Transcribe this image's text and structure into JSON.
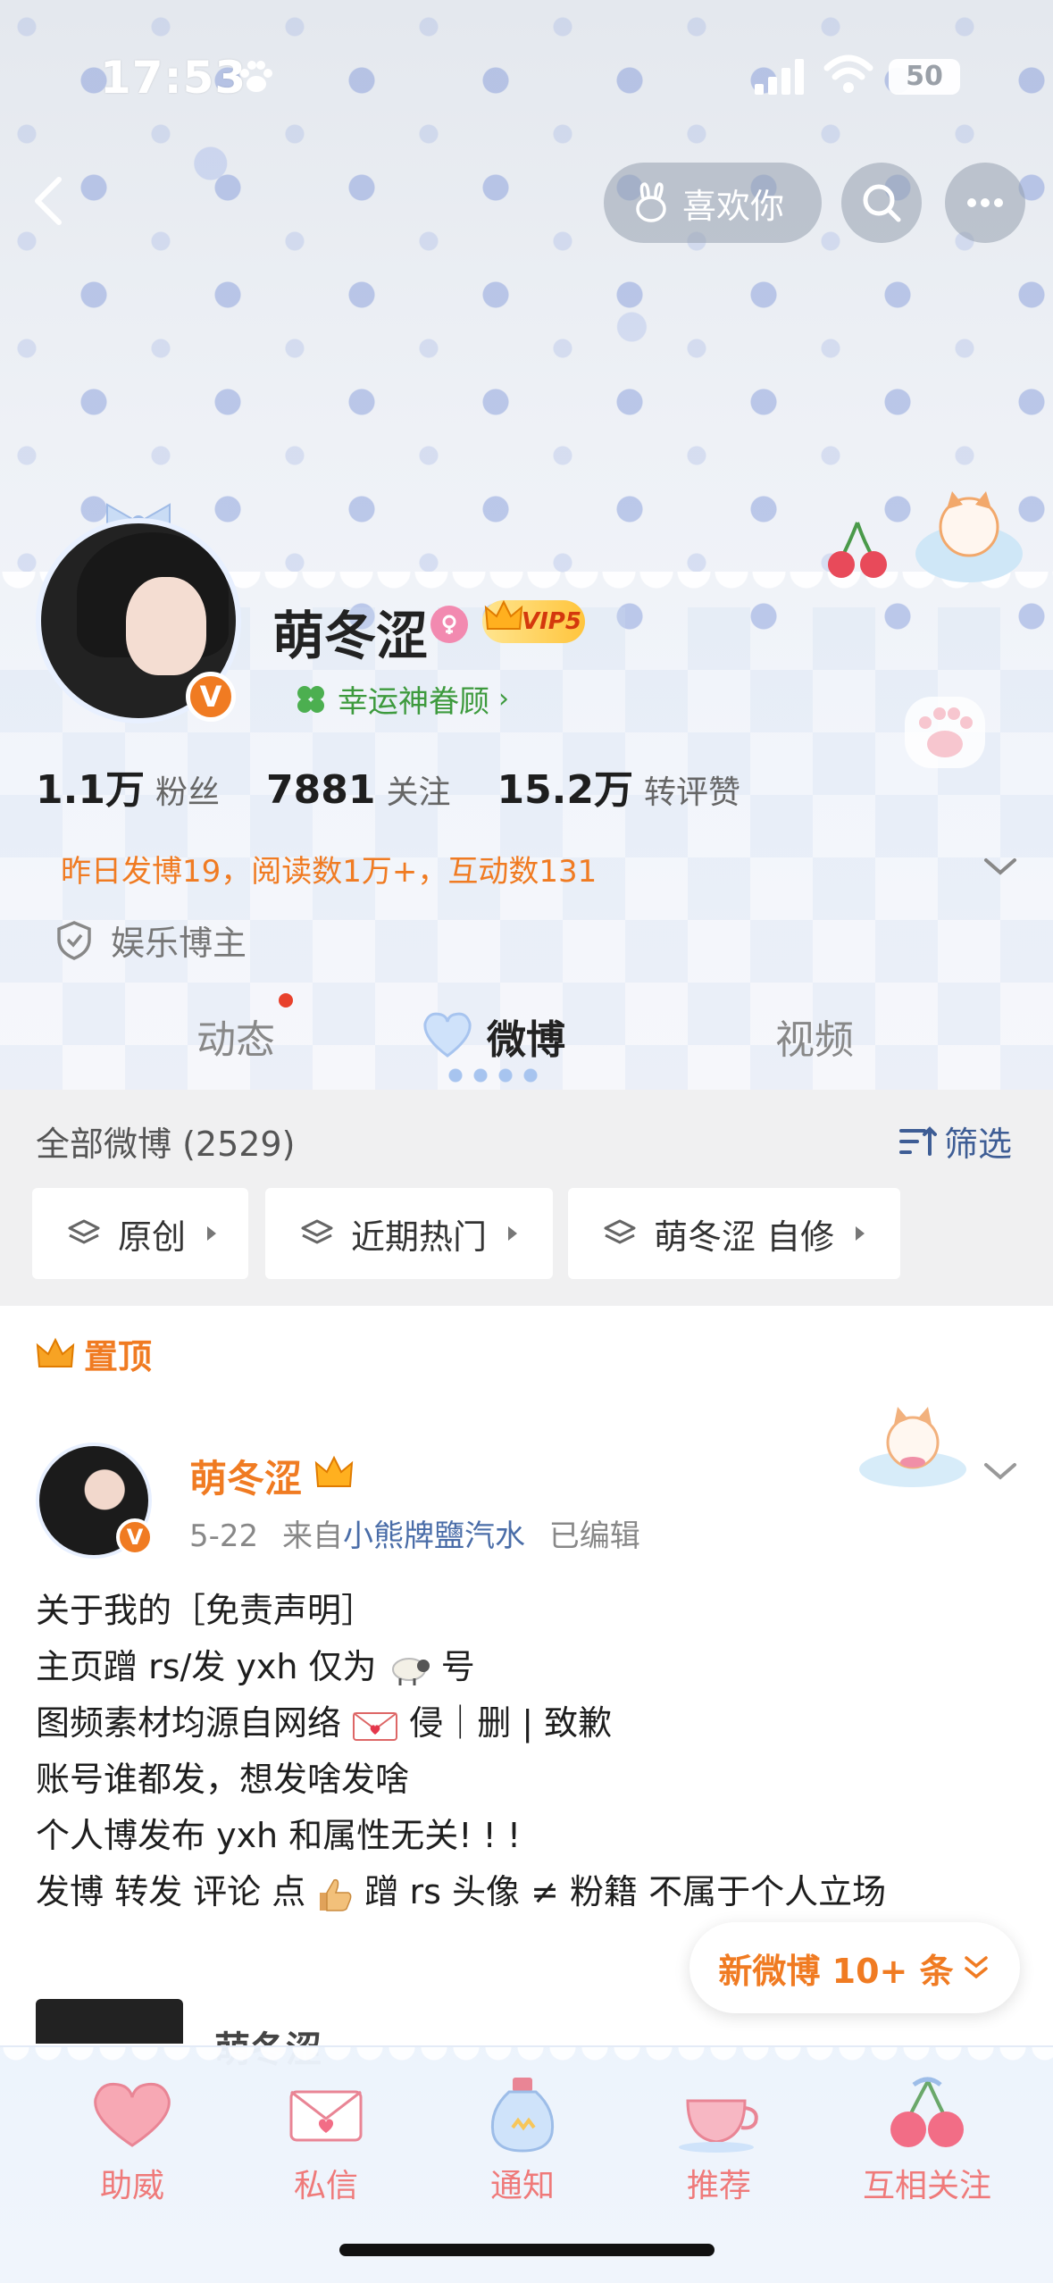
{
  "status_bar": {
    "time": "17:53",
    "battery": "50",
    "icons": [
      "paw-icon",
      "signal-icon",
      "wifi-icon",
      "battery-icon"
    ]
  },
  "top_nav": {
    "like_label": "喜欢你",
    "icons": [
      "back-icon",
      "rabbit-icon",
      "search-icon",
      "more-icon"
    ]
  },
  "profile": {
    "name": "萌冬涩",
    "vip": "VIP5",
    "verified_badge": "V",
    "lucky_text": "幸运神眷顾",
    "stats": [
      {
        "value": "1.1万",
        "label": "粉丝"
      },
      {
        "value": "7881",
        "label": "关注"
      },
      {
        "value": "15.2万",
        "label": "转评赞"
      }
    ],
    "summary": "昨日发博19，阅读数1万+，互动数131",
    "role": "娱乐博主"
  },
  "tabs": [
    {
      "label": "动态",
      "has_dot": true
    },
    {
      "label": "微博",
      "active": true
    },
    {
      "label": "视频"
    }
  ],
  "filter": {
    "all_label": "全部微博 (2529)",
    "filter_label": "筛选",
    "chips": [
      "原创",
      "近期热门",
      "萌冬涩 自修"
    ]
  },
  "pinned": {
    "label": "置顶",
    "author": "萌冬涩",
    "date": "5-22",
    "from_prefix": "来自",
    "source": "小熊牌鹽汽水",
    "edited": "已编辑",
    "lines": [
      "关于我的［免责声明］",
      "主页蹭 rs/发 yxh 仅为",
      "号",
      "图频素材均源自网络",
      "侵｜删 | 致歉",
      "账号谁都发，想发啥发啥",
      "个人博发布 yxh 和属性无关! ! !",
      "发博 转发 评论 点",
      "蹭 rs 头像 ≠ 粉籍 不属于个人立场"
    ]
  },
  "new_posts": "新微博 10+ 条",
  "next_post_author": "萌冬涩",
  "bottom_bar": [
    {
      "label": "助威",
      "icon": "heart-icon"
    },
    {
      "label": "私信",
      "icon": "letter-icon"
    },
    {
      "label": "通知",
      "icon": "bottle-icon"
    },
    {
      "label": "推荐",
      "icon": "teacup-icon"
    },
    {
      "label": "互相关注",
      "icon": "cherry-icon"
    }
  ],
  "colors": {
    "accent_orange": "#f07b22",
    "link_blue": "#4a6da8",
    "lucky_green": "#3d9a3d",
    "bottom_pink": "#ef7a7a"
  }
}
